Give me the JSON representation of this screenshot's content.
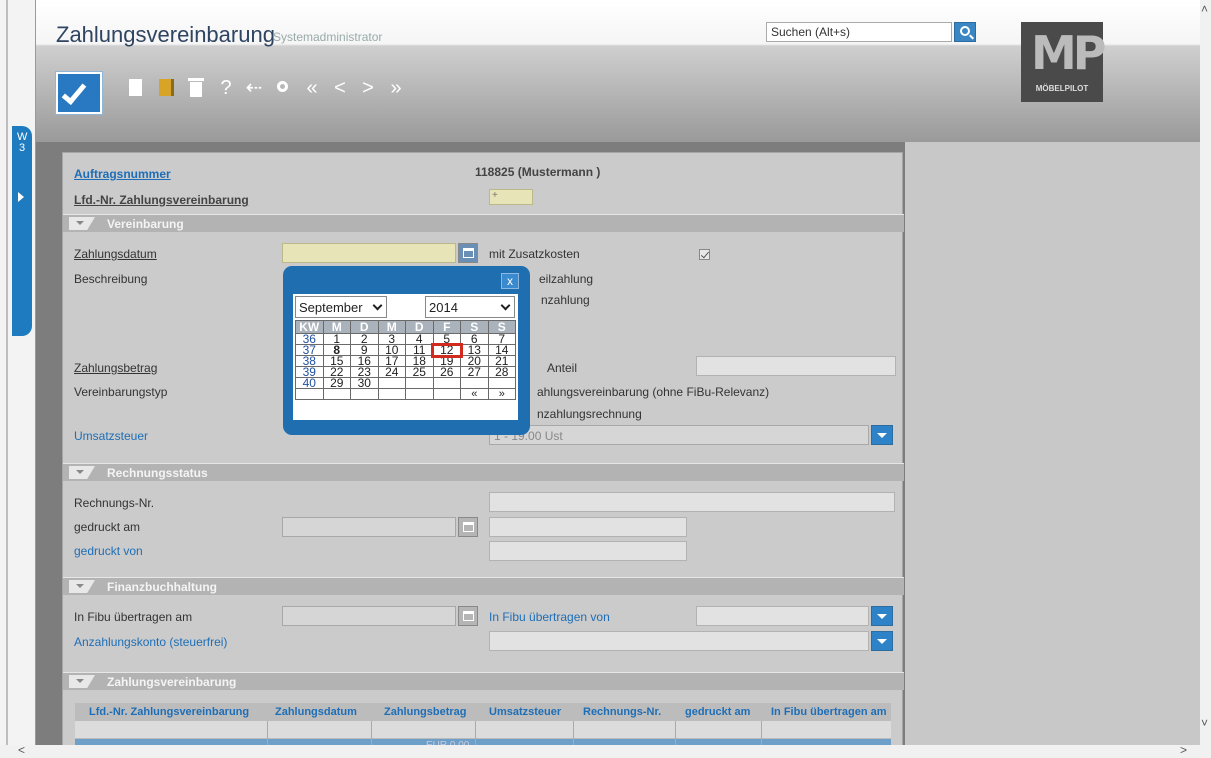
{
  "window": {
    "title": "Zahlungsvereinbarung",
    "user": "Systemadministrator",
    "search_placeholder": "Suchen (Alt+s)",
    "logo_text": "MP",
    "logo_sub": "MÖBELPILOT",
    "side_tab": "W 3"
  },
  "toolbar": {
    "help": "?",
    "back": "⇠",
    "first": "«",
    "prev": "<",
    "next": ">",
    "last": "»"
  },
  "form": {
    "auftragsnummer_label": "Auftragsnummer",
    "auftragsnummer_value": "118825 (Mustermann )",
    "lfd_label": "Lfd.-Nr. Zahlungsvereinbarung",
    "lfd_value": "+",
    "vereinbarung_section": "Vereinbarung",
    "zahlungsdatum_label": "Zahlungsdatum",
    "mit_zusatzkosten": "mit Zusatzkosten",
    "beschreibung_label": "Beschreibung",
    "teilzahlung": "eilzahlung",
    "anzahlung": "nzahlung",
    "zahlungsbetrag_label": "Zahlungsbetrag",
    "anteil_label": "Anteil",
    "vereinbarungstyp_label": "Vereinbarungstyp",
    "typ_option1": "ahlungsvereinbarung (ohne FiBu-Relevanz)",
    "typ_option2": "nzahlungsrechnung",
    "umsatzsteuer_label": "Umsatzsteuer",
    "umsatzsteuer_value": "1 - 19.00 Ust",
    "rechnungsstatus_section": "Rechnungsstatus",
    "rechnungs_nr_label": "Rechnungs-Nr.",
    "gedruckt_am_label": "gedruckt am",
    "gedruckt_von_label": "gedruckt von",
    "fibu_section": "Finanzbuchhaltung",
    "fibu_am_label": "In Fibu übertragen am",
    "fibu_von_label": "In Fibu übertragen von",
    "anzahlungskonto_label": "Anzahlungskonto (steuerfrei)",
    "zv_section": "Zahlungsvereinbarung"
  },
  "table": {
    "headers": [
      "Lfd.-Nr. Zahlungsvereinbarung",
      "Zahlungsdatum",
      "Zahlungsbetrag",
      "Umsatzsteuer",
      "Rechnungs-Nr.",
      "gedruckt am",
      "In Fibu übertragen am"
    ],
    "footer_sum": "EUR 0.00"
  },
  "calendar": {
    "close": "x",
    "month": "September",
    "year": "2014",
    "headers": [
      "KW",
      "M",
      "D",
      "M",
      "D",
      "F",
      "S",
      "S"
    ],
    "rows": [
      [
        "36",
        "1",
        "2",
        "3",
        "4",
        "5",
        "6",
        "7"
      ],
      [
        "37",
        "8",
        "9",
        "10",
        "11",
        "12",
        "13",
        "14"
      ],
      [
        "38",
        "15",
        "16",
        "17",
        "18",
        "19",
        "20",
        "21"
      ],
      [
        "39",
        "22",
        "23",
        "24",
        "25",
        "26",
        "27",
        "28"
      ],
      [
        "40",
        "29",
        "30",
        "",
        "",
        "",
        "",
        ""
      ]
    ],
    "prev": "«",
    "next": "»"
  }
}
